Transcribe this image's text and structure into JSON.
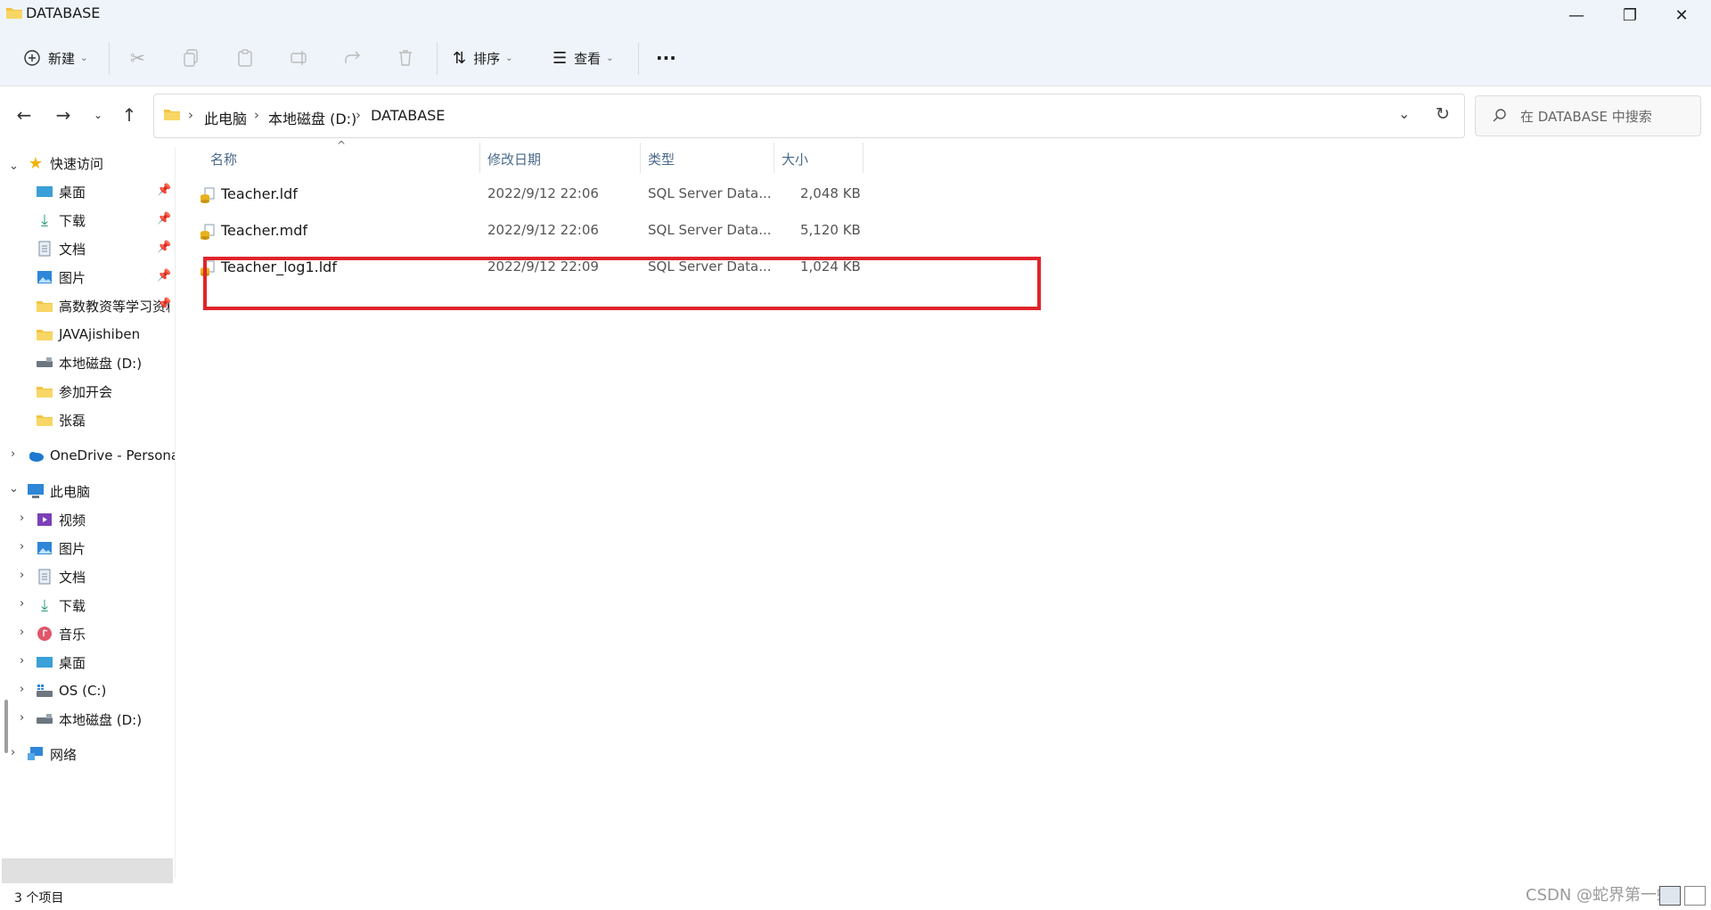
{
  "window": {
    "title": "DATABASE",
    "minimize_glyph": "—",
    "restore_glyph": "❐",
    "close_glyph": "✕"
  },
  "toolbar": {
    "new_label": "新建",
    "sort_label": "排序",
    "view_label": "查看",
    "more_label": "···"
  },
  "breadcrumb": {
    "items": [
      "此电脑",
      "本地磁盘 (D:)",
      "DATABASE"
    ]
  },
  "search": {
    "placeholder": "在 DATABASE 中搜索"
  },
  "sidebar": {
    "quick_access": "快速访问",
    "quick_items": [
      "桌面",
      "下载",
      "文档",
      "图片",
      "高数教资等学习资料",
      "JAVAjishiben",
      "本地磁盘 (D:)",
      "参加开会",
      "张磊"
    ],
    "onedrive": "OneDrive - Personal",
    "this_pc": "此电脑",
    "pc_items": [
      "视频",
      "图片",
      "文档",
      "下载",
      "音乐",
      "桌面",
      "OS (C:)",
      "本地磁盘 (D:)"
    ],
    "network": "网络",
    "selected": "本地磁盘 (D:)"
  },
  "columns": {
    "name": "名称",
    "modified": "修改日期",
    "type": "类型",
    "size": "大小"
  },
  "files": [
    {
      "name": "Teacher.ldf",
      "modified": "2022/9/12 22:06",
      "type": "SQL Server Data...",
      "size": "2,048 KB"
    },
    {
      "name": "Teacher.mdf",
      "modified": "2022/9/12 22:06",
      "type": "SQL Server Data...",
      "size": "5,120 KB"
    },
    {
      "name": "Teacher_log1.ldf",
      "modified": "2022/9/12 22:09",
      "type": "SQL Server Data...",
      "size": "1,024 KB"
    }
  ],
  "status": {
    "item_count": "3 个项目"
  },
  "watermark": "CSDN @蛇界第一蛇",
  "colors": {
    "highlight_box": "#e0242a",
    "toolbar_bg": "#eef4f9"
  }
}
